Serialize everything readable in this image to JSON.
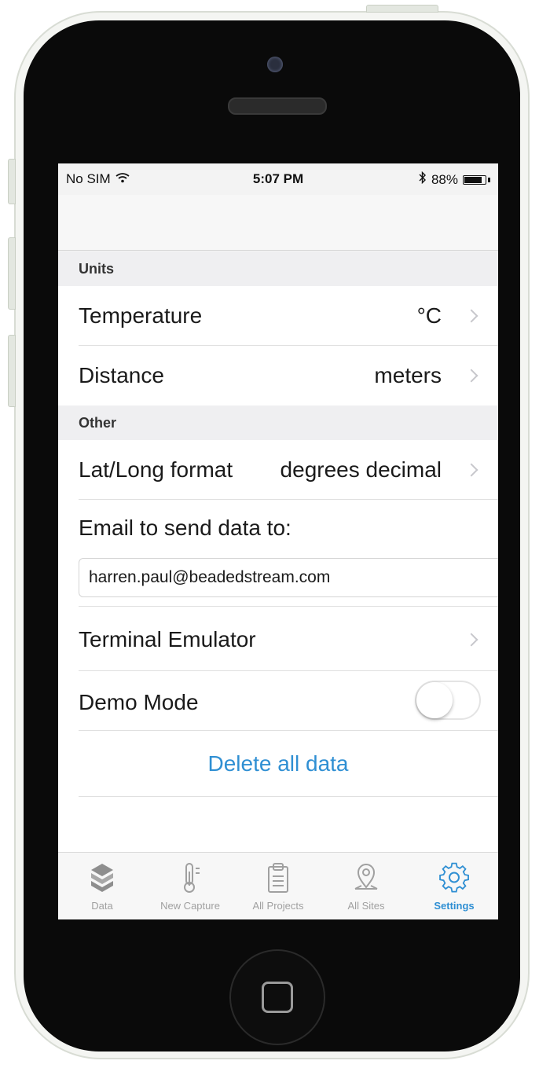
{
  "statusbar": {
    "carrier": "No SIM",
    "time": "5:07 PM",
    "battery_text": "88%",
    "battery_level": 0.88
  },
  "sections": {
    "units_header": "Units",
    "other_header": "Other"
  },
  "rows": {
    "temperature": {
      "label": "Temperature",
      "value": "°C"
    },
    "distance": {
      "label": "Distance",
      "value": "meters"
    },
    "latlong": {
      "label": "Lat/Long format",
      "value": "degrees decimal"
    },
    "email": {
      "label": "Email to send data to:",
      "value": "harren.paul@beadedstream.com"
    },
    "terminal": {
      "label": "Terminal Emulator"
    },
    "demo": {
      "label": "Demo Mode",
      "enabled": false
    },
    "delete": {
      "label": "Delete all data"
    }
  },
  "tabs": [
    {
      "label": "Data",
      "icon": "data-icon",
      "active": false
    },
    {
      "label": "New Capture",
      "icon": "thermometer-icon",
      "active": false
    },
    {
      "label": "All Projects",
      "icon": "clipboard-icon",
      "active": false
    },
    {
      "label": "All Sites",
      "icon": "map-pin-icon",
      "active": false
    },
    {
      "label": "Settings",
      "icon": "gear-icon",
      "active": true
    }
  ],
  "colors": {
    "accent": "#2f8fd3",
    "tab_inactive": "#a0a0a0"
  }
}
